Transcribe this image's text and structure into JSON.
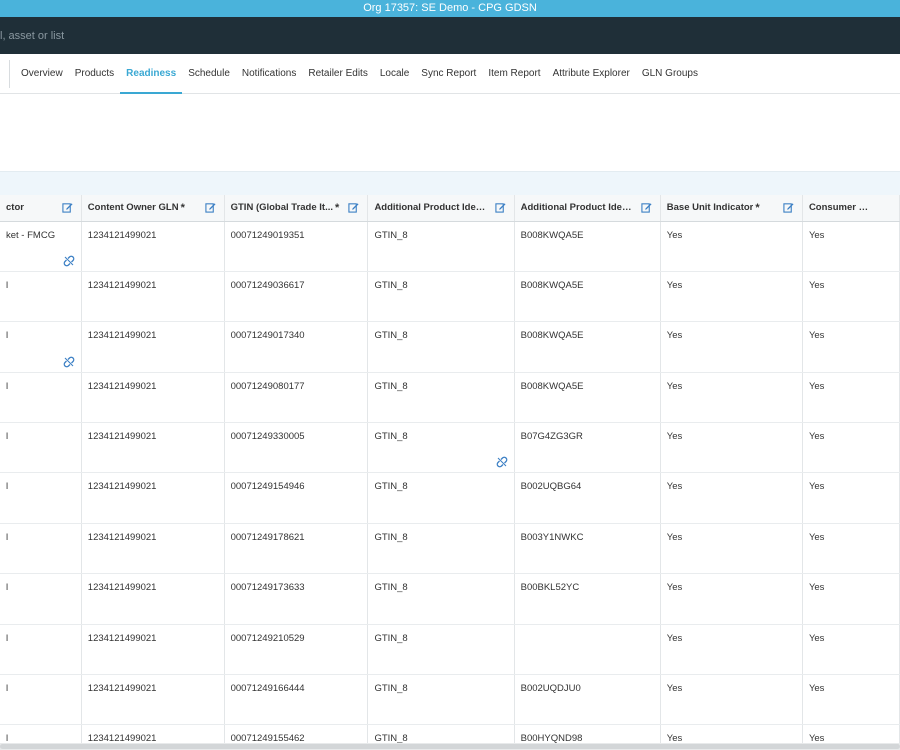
{
  "org_bar": {
    "title": "Org 17357: SE Demo - CPG GDSN"
  },
  "search": {
    "placeholder": "l, asset or list"
  },
  "nav": {
    "tabs": [
      {
        "label": "Overview",
        "active": false
      },
      {
        "label": "Products",
        "active": false
      },
      {
        "label": "Readiness",
        "active": true
      },
      {
        "label": "Schedule",
        "active": false
      },
      {
        "label": "Notifications",
        "active": false
      },
      {
        "label": "Retailer Edits",
        "active": false
      },
      {
        "label": "Locale",
        "active": false
      },
      {
        "label": "Sync Report",
        "active": false
      },
      {
        "label": "Item Report",
        "active": false
      },
      {
        "label": "Attribute Explorer",
        "active": false
      },
      {
        "label": "GLN Groups",
        "active": false
      }
    ]
  },
  "colors": {
    "accent": "#3aa8d3",
    "org_bar": "#4ab3db",
    "search_bar": "#1f2f38",
    "icon_blue": "#3b7fc4"
  },
  "grid": {
    "columns": [
      {
        "label": "ctor",
        "required": false,
        "editable": true
      },
      {
        "label": "Content Owner GLN",
        "required": true,
        "editable": true
      },
      {
        "label": "GTIN (Global Trade It...",
        "required": true,
        "editable": true
      },
      {
        "label": "Additional Product Ident...",
        "required": false,
        "editable": true
      },
      {
        "label": "Additional Product Ident...",
        "required": false,
        "editable": true
      },
      {
        "label": "Base Unit Indicator",
        "required": true,
        "editable": true
      },
      {
        "label": "Consumer Unit",
        "required": false,
        "editable": false
      }
    ],
    "rows": [
      {
        "cells": [
          "ket - FMCG",
          "1234121499021",
          "00071249019351",
          "GTIN_8",
          "B008KWQA5E",
          "Yes",
          "Yes"
        ],
        "link_col": 0
      },
      {
        "cells": [
          "l",
          "1234121499021",
          "00071249036617",
          "GTIN_8",
          "B008KWQA5E",
          "Yes",
          "Yes"
        ],
        "link_col": null
      },
      {
        "cells": [
          "l",
          "1234121499021",
          "00071249017340",
          "GTIN_8",
          "B008KWQA5E",
          "Yes",
          "Yes"
        ],
        "link_col": 0
      },
      {
        "cells": [
          "l",
          "1234121499021",
          "00071249080177",
          "GTIN_8",
          "B008KWQA5E",
          "Yes",
          "Yes"
        ],
        "link_col": null
      },
      {
        "cells": [
          "l",
          "1234121499021",
          "00071249330005",
          "GTIN_8",
          "B07G4ZG3GR",
          "Yes",
          "Yes"
        ],
        "link_col": 3
      },
      {
        "cells": [
          "l",
          "1234121499021",
          "00071249154946",
          "GTIN_8",
          "B002UQBG64",
          "Yes",
          "Yes"
        ],
        "link_col": null
      },
      {
        "cells": [
          "l",
          "1234121499021",
          "00071249178621",
          "GTIN_8",
          "B003Y1NWKC",
          "Yes",
          "Yes"
        ],
        "link_col": null
      },
      {
        "cells": [
          "l",
          "1234121499021",
          "00071249173633",
          "GTIN_8",
          "B00BKL52YC",
          "Yes",
          "Yes"
        ],
        "link_col": null
      },
      {
        "cells": [
          "l",
          "1234121499021",
          "00071249210529",
          "GTIN_8",
          "",
          "Yes",
          "Yes"
        ],
        "link_col": null
      },
      {
        "cells": [
          "l",
          "1234121499021",
          "00071249166444",
          "GTIN_8",
          "B002UQDJU0",
          "Yes",
          "Yes"
        ],
        "link_col": null
      },
      {
        "cells": [
          "l",
          "1234121499021",
          "00071249155462",
          "GTIN_8",
          "B00HYQND98",
          "Yes",
          "Yes"
        ],
        "link_col": null
      }
    ]
  }
}
